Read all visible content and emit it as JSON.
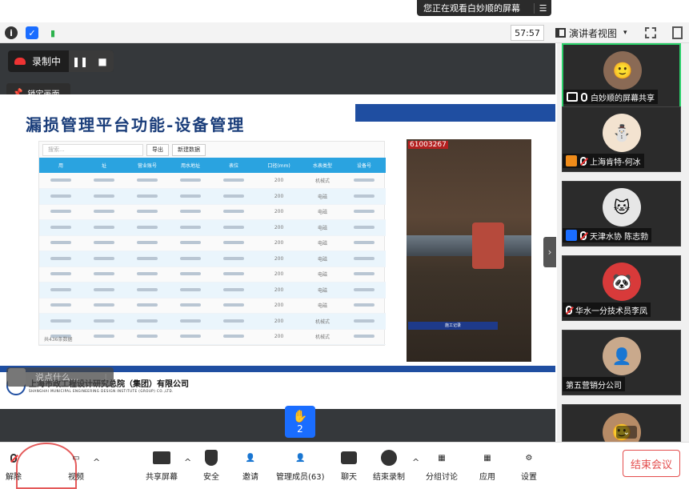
{
  "banner": {
    "viewing": "您正在观看白妙顺的屏幕",
    "menu_icon": "menu-icon"
  },
  "infobar": {
    "timer": "57:57",
    "view_mode": "演讲者视图",
    "view_caret": "▾"
  },
  "recording": {
    "label": "录制中",
    "pause": "❚❚",
    "stop": "■"
  },
  "lock_view": "锁定画面",
  "slide": {
    "title": "漏损管理平台功能-设备管理",
    "search_placeholder": "搜索...",
    "buttons": [
      "导出",
      "新建数据"
    ],
    "columns": [
      "用",
      "址",
      "营业账号",
      "用水地址",
      "表位",
      "口径(mm)",
      "水表类型",
      "设备号"
    ],
    "rows": [
      {
        "caliber": "200",
        "type": "机械式"
      },
      {
        "caliber": "200",
        "type": "电磁"
      },
      {
        "caliber": "200",
        "type": "电磁"
      },
      {
        "caliber": "200",
        "type": "电磁"
      },
      {
        "caliber": "200",
        "type": "电磁"
      },
      {
        "caliber": "200",
        "type": "电磁"
      },
      {
        "caliber": "200",
        "type": "电磁"
      },
      {
        "caliber": "200",
        "type": "电磁"
      },
      {
        "caliber": "200",
        "type": "电磁"
      },
      {
        "caliber": "200",
        "type": "机械式"
      },
      {
        "caliber": "200",
        "type": "机械式"
      }
    ],
    "table_footer": "共436条数据",
    "photo_tag": "61003267",
    "photo_note": "施工记录",
    "company_cn": "上海市政工程设计研究总院（集团）有限公司",
    "company_en": "SHANGHAI MUNICIPAL ENGINEERING DESIGN INSTITUTE (GROUP) CO.,LTD."
  },
  "comment_box": {
    "placeholder": "说点什么...",
    "separator": "|"
  },
  "raise_hand": {
    "count": "2"
  },
  "participants": [
    {
      "name": "白妙顺的屏幕共享",
      "active": true
    },
    {
      "name": "上海肯特-何冰"
    },
    {
      "name": "天津水协 陈志勃"
    },
    {
      "name": "华水一分技术员李凤"
    },
    {
      "name": "第五营销分公司"
    }
  ],
  "toolbar": {
    "unmute": "解除",
    "video": "视频",
    "share": "共享屏幕",
    "security": "安全",
    "invite": "邀请",
    "members": "管理成员(63)",
    "chat": "聊天",
    "end_record": "结束录制",
    "breakout": "分组讨论",
    "apps": "应用",
    "settings": "设置",
    "end_meeting": "结束会议"
  },
  "colors": {
    "accent": "#1a6dff",
    "danger": "#e34c4c",
    "active_border": "#2bd16a",
    "slide_blue": "#1f4ea1"
  }
}
